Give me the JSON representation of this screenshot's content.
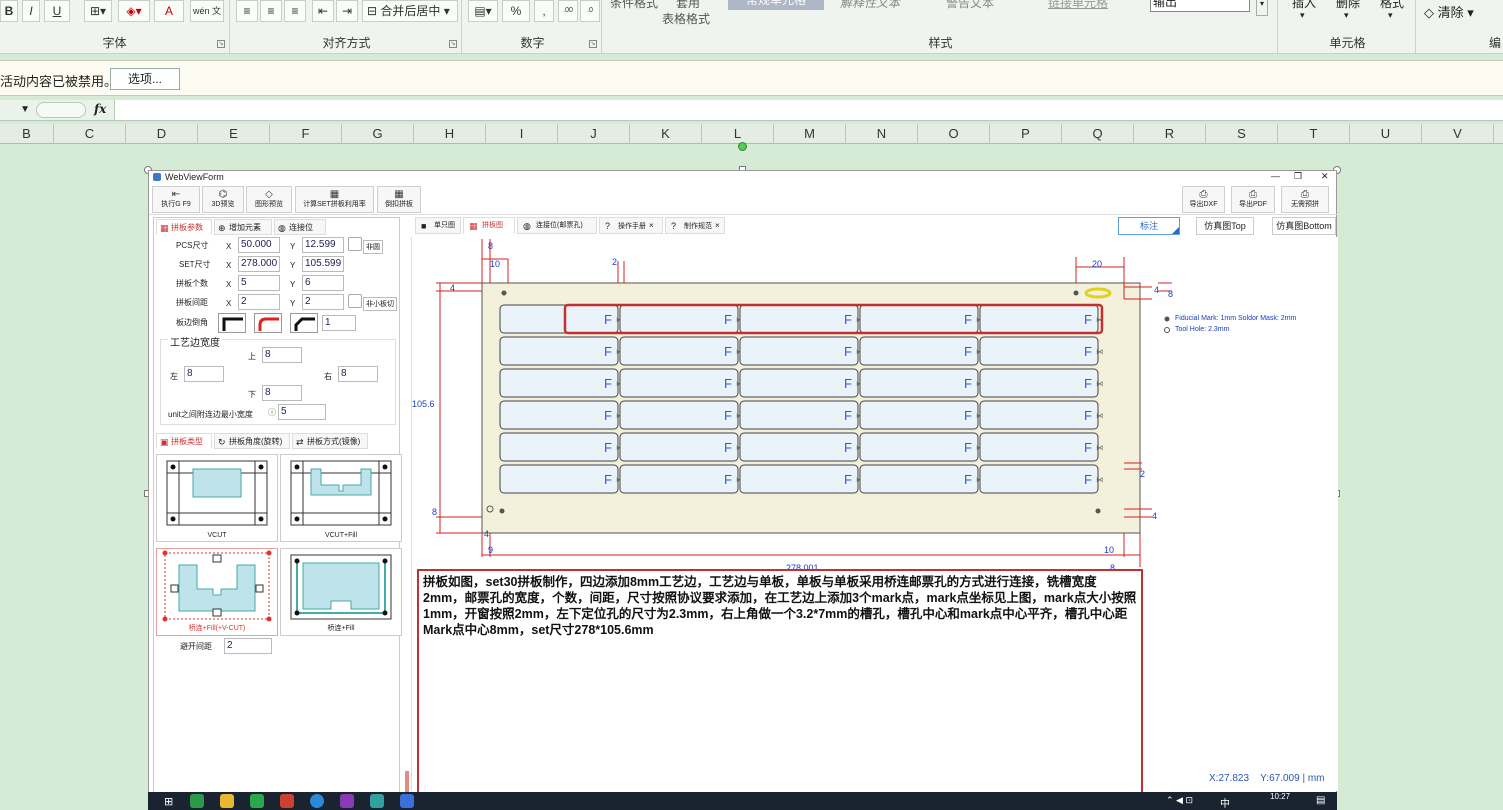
{
  "ribbon": {
    "font_group_label": "字体",
    "align_group_label": "对齐方式",
    "number_group_label": "数字",
    "styles_group_label": "样式",
    "cells_group_label": "单元格",
    "edit_group_label": "编",
    "bold": "B",
    "italic": "I",
    "underline": "U",
    "font_color": "A",
    "wen": "wén 文",
    "merge_center": "合并后居中",
    "percent": "%",
    "comma": ",",
    "cond_format": "条件格式",
    "table_format_1": "套用",
    "table_format_2": "表格格式",
    "style_normal": "常规单元格",
    "style_explain": "解释性文本",
    "style_warn": "警告文本",
    "style_link": "链接单元格",
    "style_output": "输出",
    "insert": "插入",
    "delete": "删除",
    "format": "格式",
    "clear": "清除"
  },
  "security_bar": {
    "message": "活动内容已被禁用。",
    "options_button": "选项..."
  },
  "formula_bar": {
    "fx": "fx",
    "name_box": ""
  },
  "columns": [
    "B",
    "C",
    "D",
    "E",
    "F",
    "G",
    "H",
    "I",
    "J",
    "K",
    "L",
    "M",
    "N",
    "O",
    "P",
    "Q",
    "R",
    "S",
    "T",
    "U",
    "V"
  ],
  "window": {
    "title": "WebViewForm",
    "minimize": "—",
    "restore": "❐",
    "close": "✕",
    "toolbar_left": [
      {
        "icon": "⇤",
        "label": "执行G F9"
      },
      {
        "icon": "⌬",
        "label": "3D预览"
      },
      {
        "icon": "◇",
        "label": "图形预览"
      },
      {
        "icon": "▦",
        "label": "计算SET拼板利用率"
      },
      {
        "icon": "▦",
        "label": "倒扣拼板"
      }
    ],
    "toolbar_right": [
      {
        "icon": "⎙",
        "label": "导出DXF"
      },
      {
        "icon": "⎙",
        "label": "导出PDF"
      },
      {
        "icon": "⎙",
        "label": "无需预拼"
      }
    ]
  },
  "left_panel": {
    "tabs": [
      "拼板参数",
      "增加元素",
      "连接位"
    ],
    "pcs_label": "PCS尺寸",
    "set_label": "SET尺寸",
    "count_label": "拼板个数",
    "gap_label": "拼板间距",
    "corner_label": "板边倒角",
    "x": "X",
    "y": "Y",
    "pcs_x": "50.000",
    "pcs_y": "12.599",
    "set_x": "278.000",
    "set_y": "105.599",
    "count_x": "5",
    "count_y": "6",
    "gap_x": "2",
    "gap_y": "2",
    "nonround": "非圆",
    "small_cut": "非小板切",
    "corner_value": "1",
    "edge_group": "工艺边宽度",
    "top_label": "上",
    "top_value": "8",
    "left_label": "左",
    "left_value": "8",
    "right_label": "右",
    "right_value": "8",
    "bottom_label": "下",
    "bottom_value": "8",
    "unit_min_label": "unit之间附连边最小宽度",
    "unit_min_value": "5",
    "tabs2": [
      "拼板类型",
      "拼板角度(旋转)",
      "拼板方式(镜像)"
    ],
    "cards": [
      "VCUT",
      "VCUT+Fill",
      "桥连+Fill(+V-CUT)",
      "桥连+Fill"
    ],
    "avoid_label": "避开间距",
    "avoid_value": "2"
  },
  "right": {
    "tabs": [
      "单只图",
      "拼板图",
      "连接位(邮票孔)",
      "操作手册",
      "制作规范"
    ],
    "mark_btn": "标注",
    "sim_top": "仿真图Top",
    "sim_bottom": "仿真图Bottom",
    "legend_fiducial": "Fiducial Mark: 1mm  Soldor Mask: 2mm",
    "legend_tool": "Tool Hole: 2.3mm",
    "dims": {
      "d8_top": "8",
      "d10": "10",
      "d2": "2",
      "d20": "20",
      "d4_left": "4",
      "d4_right": "4",
      "d8_right": "8",
      "d105": "105.6",
      "d2_right": "2",
      "d8_left_bottom": "8",
      "d4_bottom_right": "4",
      "d4_bottom_left": "4",
      "d9": "9",
      "d278": "278.001",
      "d10_bottom": "10",
      "d8_bottom": "8"
    },
    "unit_letter": "F",
    "coords_x": "X:27.823",
    "coords_y": "Y:67.009",
    "coords_unit": "| mm",
    "description": "拼板如图，set30拼板制作，四边添加8mm工艺边，工艺边与单板，单板与单板采用桥连邮票孔的方式进行连接，铣槽宽度2mm，邮票孔的宽度，个数，间距，尺寸按照协议要求添加，在工艺边上添加3个mark点，mark点坐标见上图，mark点大小按照1mm，开窗按照2mm，左下定位孔的尺寸为2.3mm，右上角做一个3.2*7mm的槽孔，槽孔中心和mark点中心平齐，槽孔中心距Mark点中心8mm，set尺寸278*105.6mm"
  },
  "taskbar": {
    "ime": "中",
    "time": "10:27"
  },
  "colors": {
    "accent_red": "#c23030",
    "board_fill": "#f3f1dc",
    "unit_fill": "#eaf2fa",
    "dim_red": "#d62020",
    "dim_blue": "#1a3cc4"
  }
}
